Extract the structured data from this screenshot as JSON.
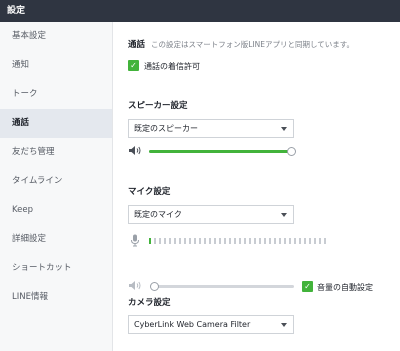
{
  "window": {
    "title": "設定"
  },
  "sidebar": {
    "items": [
      {
        "label": "基本設定"
      },
      {
        "label": "通知"
      },
      {
        "label": "トーク"
      },
      {
        "label": "通話"
      },
      {
        "label": "友だち管理"
      },
      {
        "label": "タイムライン"
      },
      {
        "label": "Keep"
      },
      {
        "label": "詳細設定"
      },
      {
        "label": "ショートカット"
      },
      {
        "label": "LINE情報"
      }
    ],
    "active_index": 3
  },
  "call": {
    "title": "通話",
    "note": "この設定はスマートフォン版LINEアプリと同期しています。",
    "allow_incoming_label": "通話の着信許可",
    "allow_incoming_checked": true
  },
  "speaker": {
    "title": "スピーカー設定",
    "selected": "既定のスピーカー",
    "volume_fraction": 1.0,
    "icon": "speaker-icon"
  },
  "mic": {
    "title": "マイク設定",
    "selected": "既定のマイク",
    "level_active_bars": 1,
    "level_total_bars": 36,
    "volume_fraction": 0.0,
    "auto_volume_label": "音量の自動設定",
    "auto_volume_checked": true,
    "icons": [
      "microphone-icon",
      "speaker-muted-icon"
    ]
  },
  "camera": {
    "title": "カメラ設定",
    "selected": "CyberLink Web Camera Filter"
  },
  "colors": {
    "accent": "#42b33b",
    "titlebar": "#2f3541",
    "sidebar_bg": "#f7f8f9",
    "active_item_bg": "#e4e8ee"
  }
}
